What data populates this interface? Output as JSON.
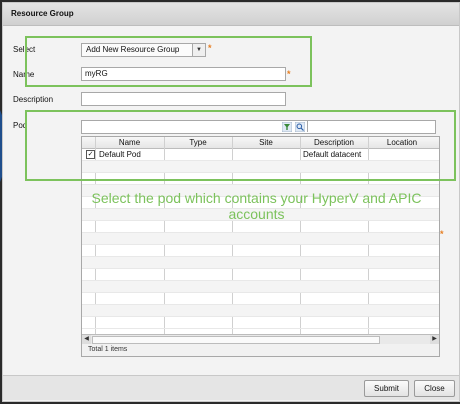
{
  "dialog": {
    "title": "Resource Group"
  },
  "form": {
    "select_label": "Select",
    "select_value": "Add New Resource Group",
    "name_label": "Name",
    "name_value": "myRG",
    "description_label": "Description",
    "description_value": "",
    "pod_label": "Pod",
    "required_mark": "*"
  },
  "pod_table": {
    "columns": [
      "Name",
      "Type",
      "Site",
      "Description",
      "Location"
    ],
    "rows": [
      {
        "checked": true,
        "name": "Default Pod",
        "type": "",
        "site": "",
        "description": "Default datacent",
        "location": ""
      }
    ],
    "total": "Total 1 items"
  },
  "annotation": {
    "text": "Select the pod which contains your HyperV and APIC accounts",
    "color": "#7cc25c"
  },
  "buttons": {
    "submit": "Submit",
    "close": "Close"
  },
  "colors": {
    "highlight": "#7cc25c",
    "required": "#e67e22",
    "arrow": "#1f4e8c"
  },
  "icons": [
    "filter-icon",
    "search-icon",
    "chevron-down-icon",
    "scroll-left-icon",
    "scroll-right-icon",
    "checkbox-icon"
  ]
}
